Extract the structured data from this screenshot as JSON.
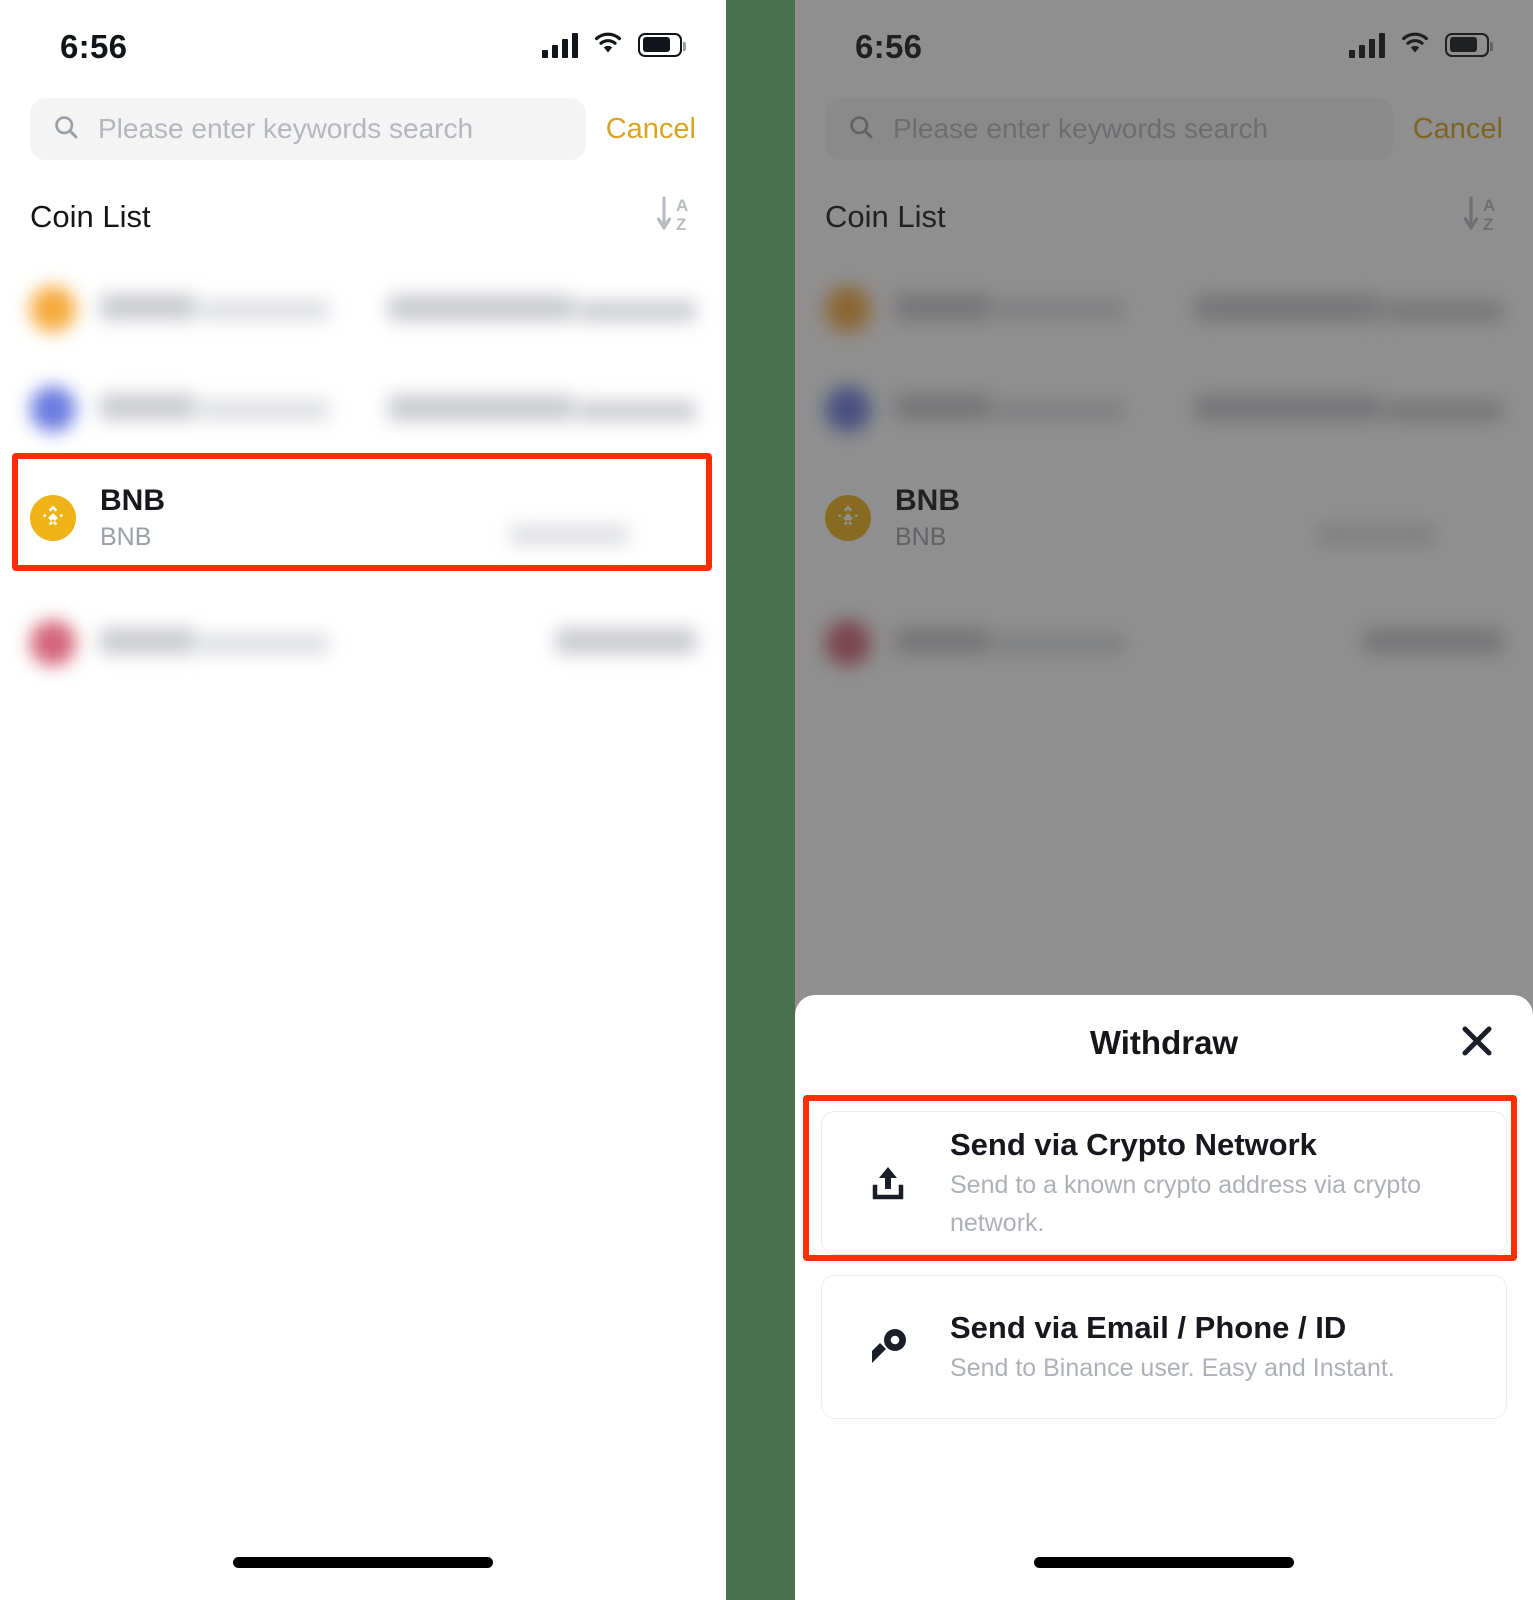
{
  "meta": {
    "app": "Binance",
    "accent_gold": "#D9A420",
    "highlight_red": "#FF2D00",
    "divider_green": "#4A714D",
    "bnb_icon_color": "#EFB217"
  },
  "status_bar": {
    "time": "6:56",
    "cellular_icon": "cellular-signal-icon",
    "wifi_icon": "wifi-icon",
    "battery_icon": "battery-icon"
  },
  "search": {
    "placeholder": "Please enter keywords search",
    "value": "",
    "icon": "search-icon",
    "cancel_label": "Cancel"
  },
  "coin_list": {
    "title": "Coin List",
    "sort_icon": "sort-alpha-descending-icon",
    "rows": [
      {
        "name": "",
        "symbol": "",
        "amount": "",
        "value": "",
        "redacted": true,
        "icon_color": "#F6A93B"
      },
      {
        "name": "",
        "symbol": "",
        "amount": "",
        "value": "",
        "redacted": true,
        "icon_color": "#6A7BE0"
      },
      {
        "name": "BNB",
        "symbol": "BNB",
        "amount": "",
        "value": "",
        "redacted": false,
        "icon_color": "#EFB217",
        "highlighted": true
      },
      {
        "name": "",
        "symbol": "",
        "amount": "",
        "value": "",
        "redacted": true,
        "icon_color": "#D4637A"
      }
    ]
  },
  "withdraw_sheet": {
    "title": "Withdraw",
    "close_icon": "close-icon",
    "options": [
      {
        "title": "Send via Crypto Network",
        "description": "Send to a known crypto address via crypto network.",
        "icon": "upload-icon",
        "highlighted": true
      },
      {
        "title": "Send via Email / Phone / ID",
        "description": "Send to Binance user. Easy and Instant.",
        "icon": "send-user-icon",
        "highlighted": false
      }
    ]
  },
  "home_indicator": "home-indicator"
}
